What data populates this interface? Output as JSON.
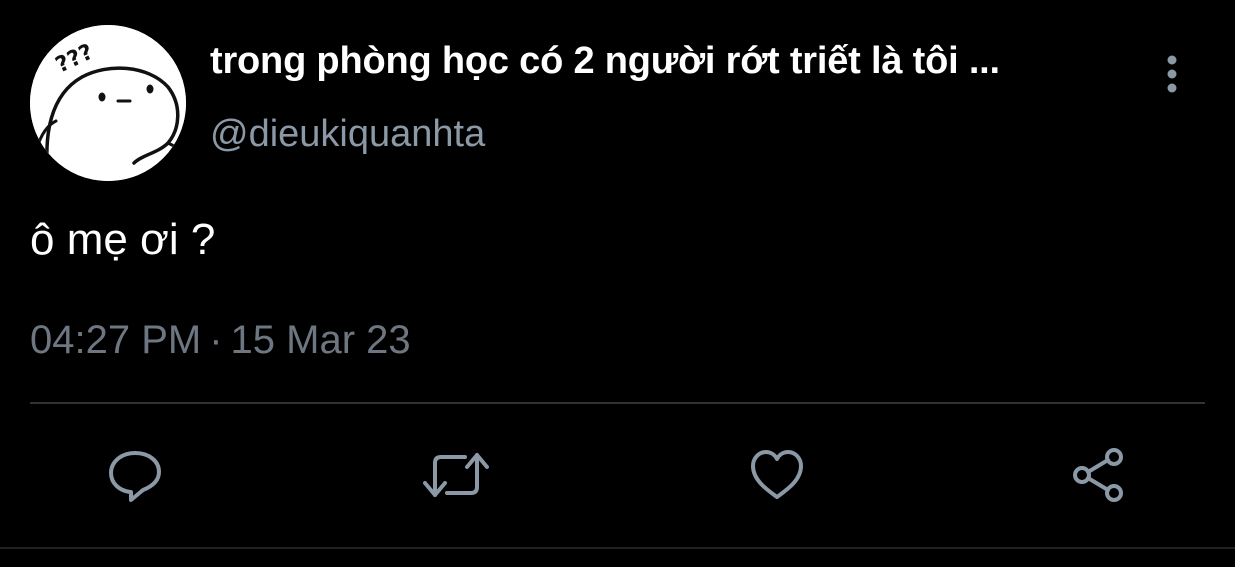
{
  "tweet": {
    "display_name": "trong phòng học có 2 người rớt triết là tôi ...",
    "handle": "@dieukiquanhta",
    "text": "ô mẹ ơi ?",
    "time": "04:27 PM",
    "separator": "·",
    "date": "15 Mar 23",
    "avatar_text": "???"
  },
  "actions": [
    {
      "name": "reply",
      "icon": "speech-bubble-icon"
    },
    {
      "name": "retweet",
      "icon": "retweet-icon"
    },
    {
      "name": "like",
      "icon": "heart-icon"
    },
    {
      "name": "share",
      "icon": "share-icon"
    }
  ],
  "more_menu": {
    "icon": "vertical-ellipsis-icon"
  },
  "colors": {
    "background": "#000000",
    "text_primary": "#ffffff",
    "text_secondary": "#8b98a5",
    "timestamp": "#6e7781",
    "divider": "#2f3336",
    "icon": "#8b98a5"
  }
}
